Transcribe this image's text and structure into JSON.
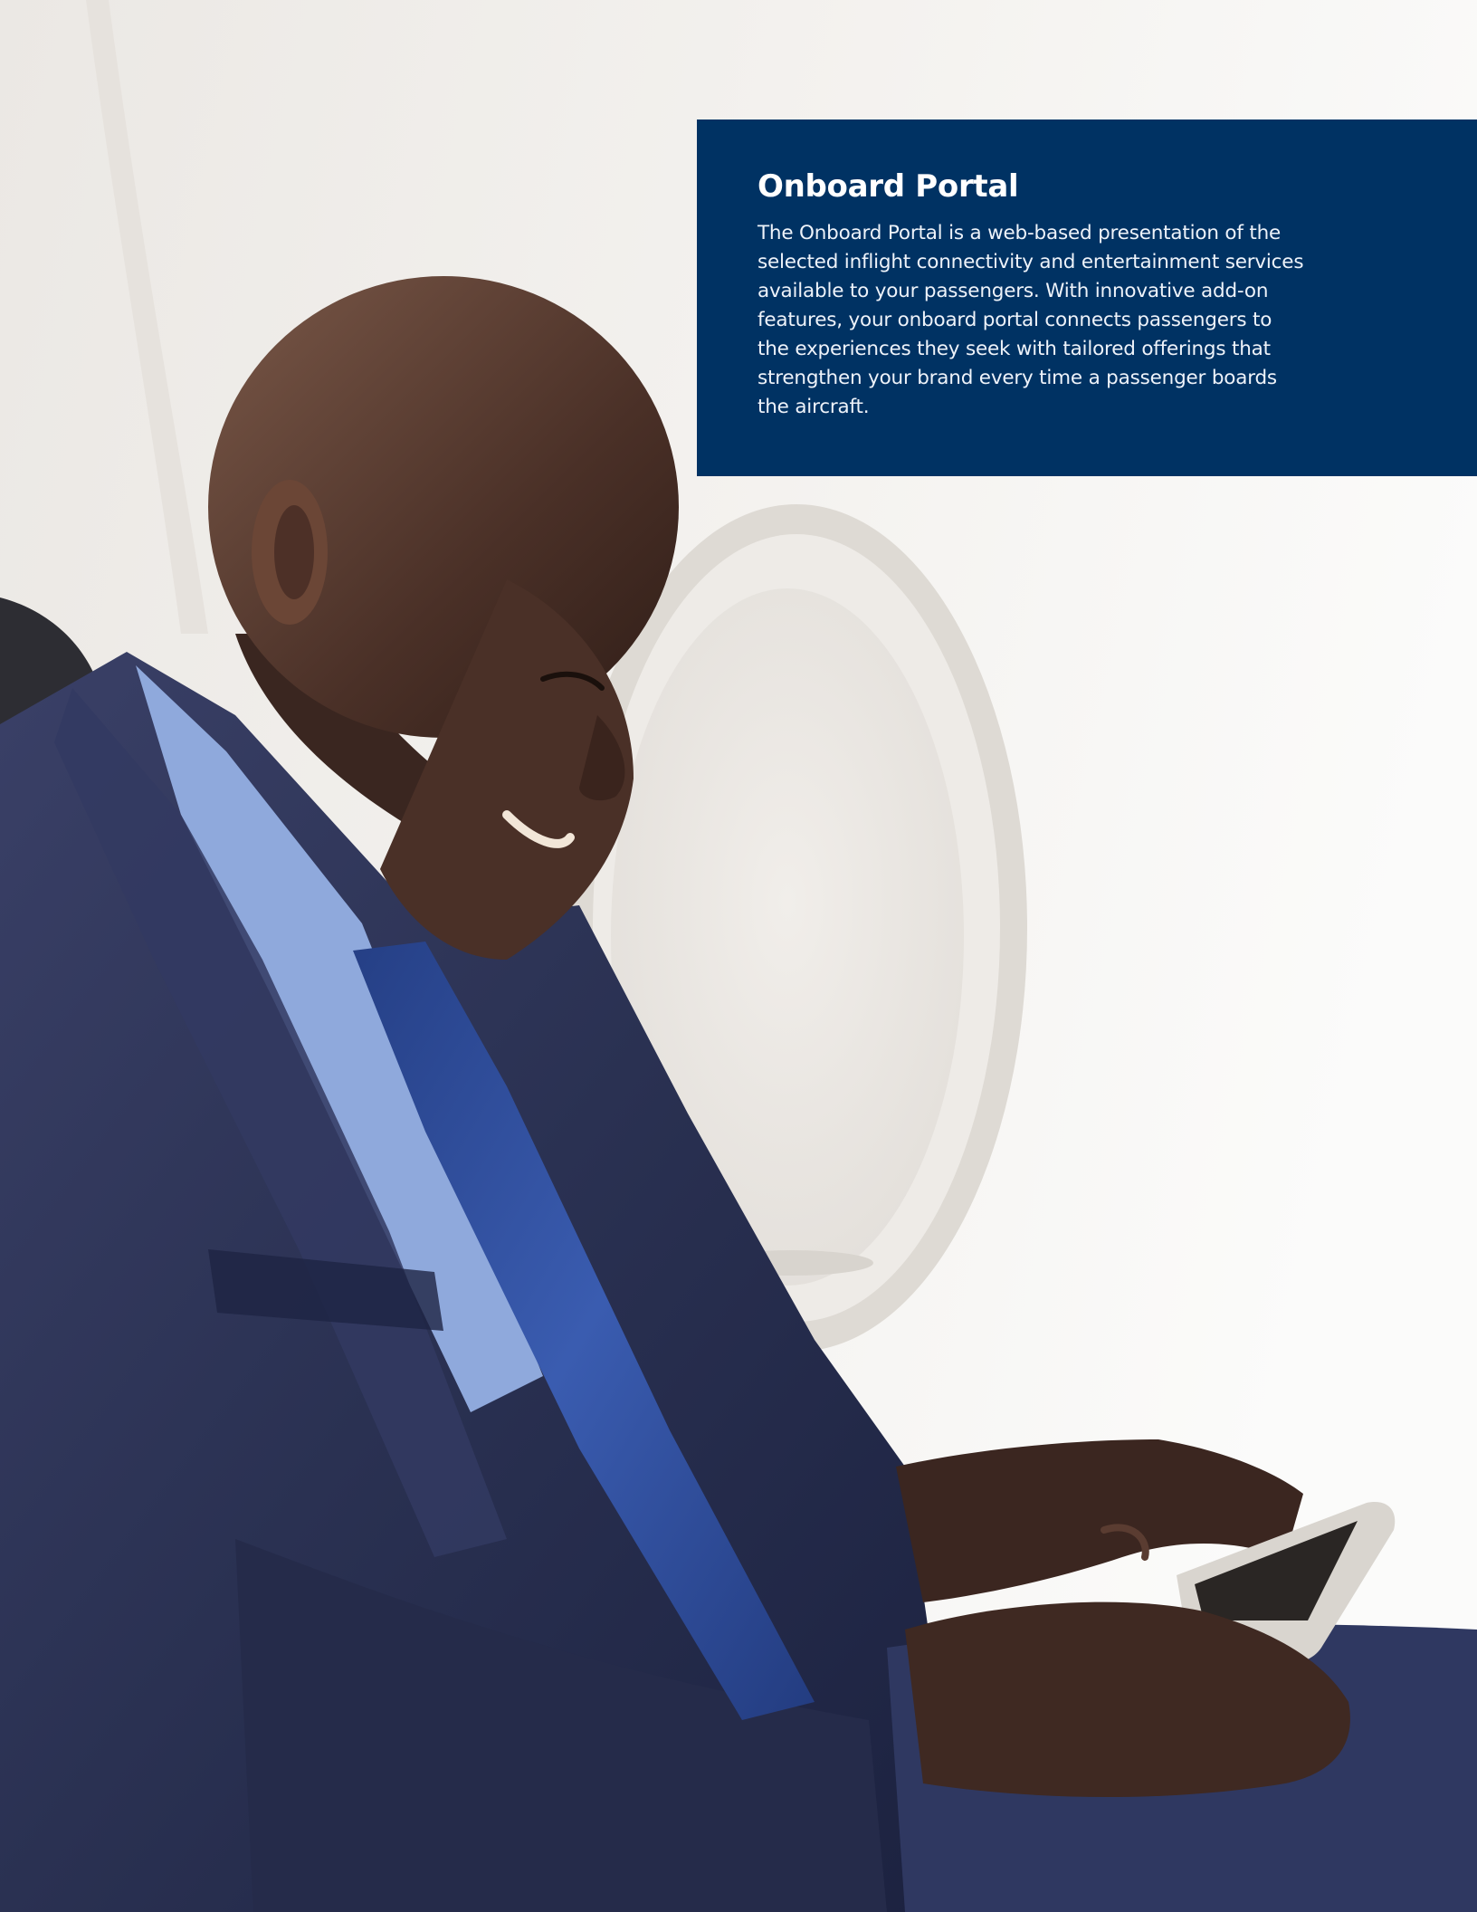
{
  "info_box": {
    "title": "Onboard Portal",
    "body": "The Onboard Portal is a web-based presentation of the selected inflight connectivity and entertainment services available to your passengers. With innovative add-on features, your onboard portal connects passengers to the experiences they seek with tailored offerings that strengthen your brand every time a passenger boards the aircraft."
  },
  "colors": {
    "info_box_background": "#003263",
    "cabin_wall": "#f3f1ee",
    "suit": "#2a3152",
    "tie": "#2f4f9c",
    "shirt": "#8fa9dc"
  },
  "photo": {
    "subject": "passenger-using-smartphone-icon"
  }
}
